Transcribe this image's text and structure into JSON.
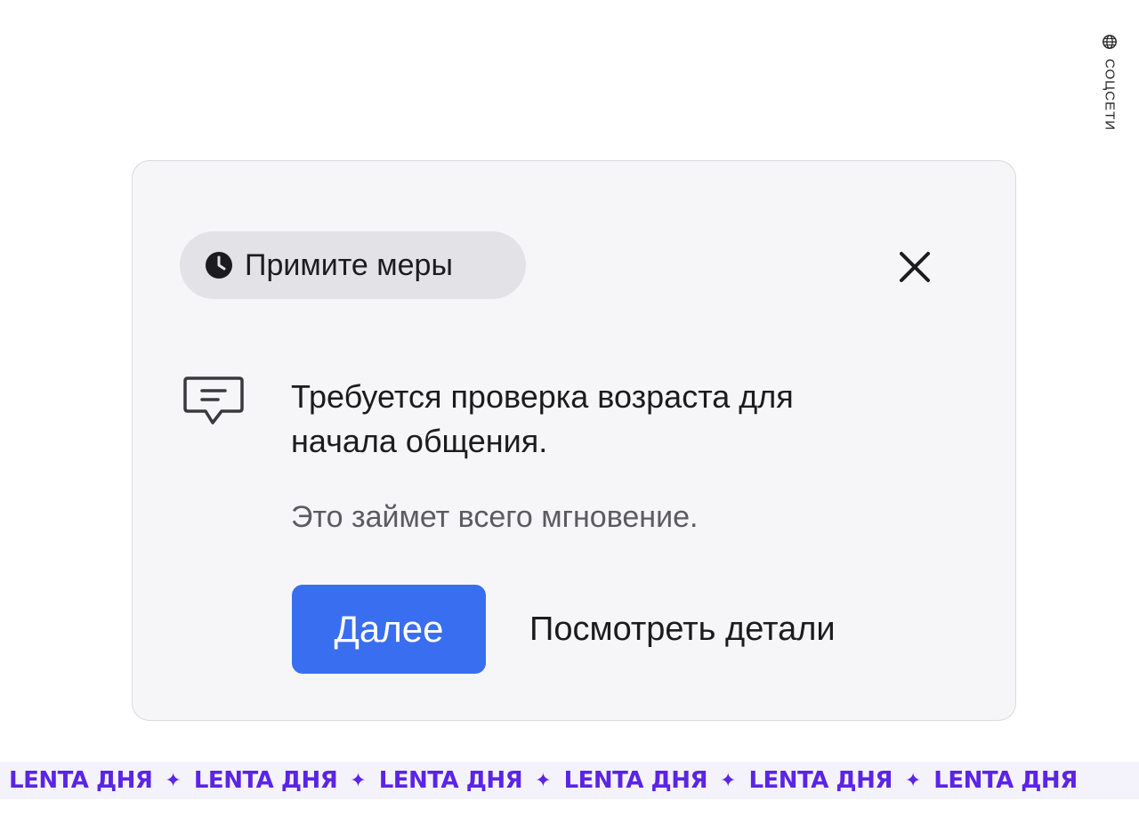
{
  "side_tag": {
    "icon": "globe-icon",
    "label": "СОЦСЕТИ"
  },
  "dialog": {
    "chip": {
      "icon": "clock-icon",
      "label": "Примите меры"
    },
    "close_icon": "close-icon",
    "message_icon": "message-icon",
    "headline_line1": "Требуется проверка возраста для",
    "headline_line2": "начала общения.",
    "subtext": "Это займет всего мгновение.",
    "primary_button": "Далее",
    "secondary_link": "Посмотреть детали"
  },
  "ticker": {
    "items": [
      "LENTA ДНЯ",
      "LENTA ДНЯ",
      "LENTA ДНЯ",
      "LENTA ДНЯ",
      "LENTA ДНЯ",
      "LENTA ДНЯ"
    ],
    "separator": "✦",
    "color": "#5b24e6"
  },
  "colors": {
    "primary_button": "#3a6ef0",
    "card_background": "#f6f6f9",
    "chip_background": "#e2e2e7"
  }
}
